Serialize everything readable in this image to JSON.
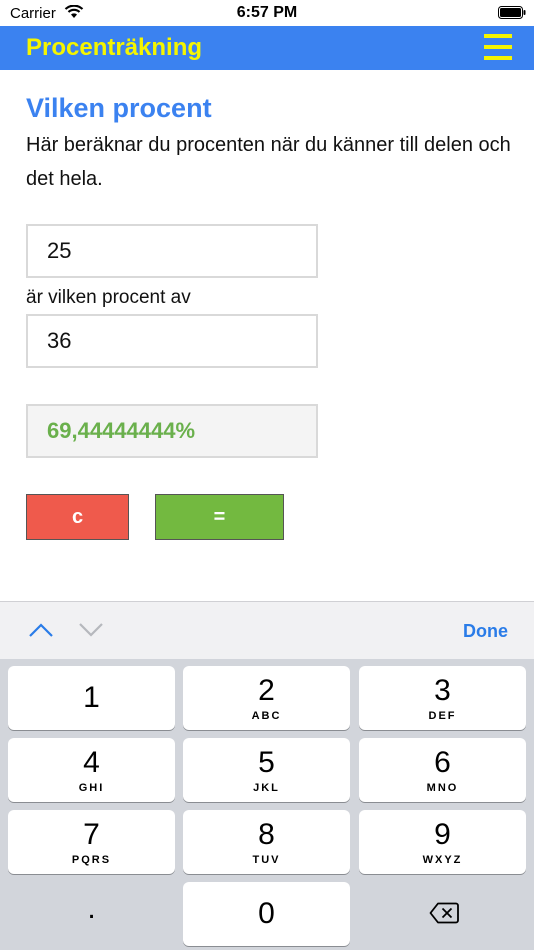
{
  "status_bar": {
    "carrier": "Carrier",
    "time": "6:57 PM"
  },
  "app_bar": {
    "title": "Procenträkning"
  },
  "main": {
    "heading": "Vilken procent",
    "description": "Här beräknar du procenten när du känner till delen och det hela.",
    "part_value": "25",
    "between_label": "är vilken procent av",
    "whole_value": "36",
    "result": "69,44444444%",
    "clear_label": "c",
    "equals_label": "="
  },
  "accessory": {
    "done_label": "Done"
  },
  "keypad": {
    "keys": [
      {
        "num": "1",
        "letters": ""
      },
      {
        "num": "2",
        "letters": "ABC"
      },
      {
        "num": "3",
        "letters": "DEF"
      },
      {
        "num": "4",
        "letters": "GHI"
      },
      {
        "num": "5",
        "letters": "JKL"
      },
      {
        "num": "6",
        "letters": "MNO"
      },
      {
        "num": "7",
        "letters": "PQRS"
      },
      {
        "num": "8",
        "letters": "TUV"
      },
      {
        "num": "9",
        "letters": "WXYZ"
      }
    ],
    "dot": ".",
    "zero": "0"
  },
  "colors": {
    "app_bar": "#3b82f0",
    "title": "#f5f500",
    "heading": "#3b82f0",
    "result_text": "#6ab04c",
    "clear_button": "#ef5a4c",
    "equals_button": "#73b940",
    "done": "#2a7ce8"
  },
  "icons": [
    "wifi-icon",
    "battery-icon",
    "menu-icon",
    "chevron-up-icon",
    "chevron-down-icon",
    "delete-icon"
  ]
}
